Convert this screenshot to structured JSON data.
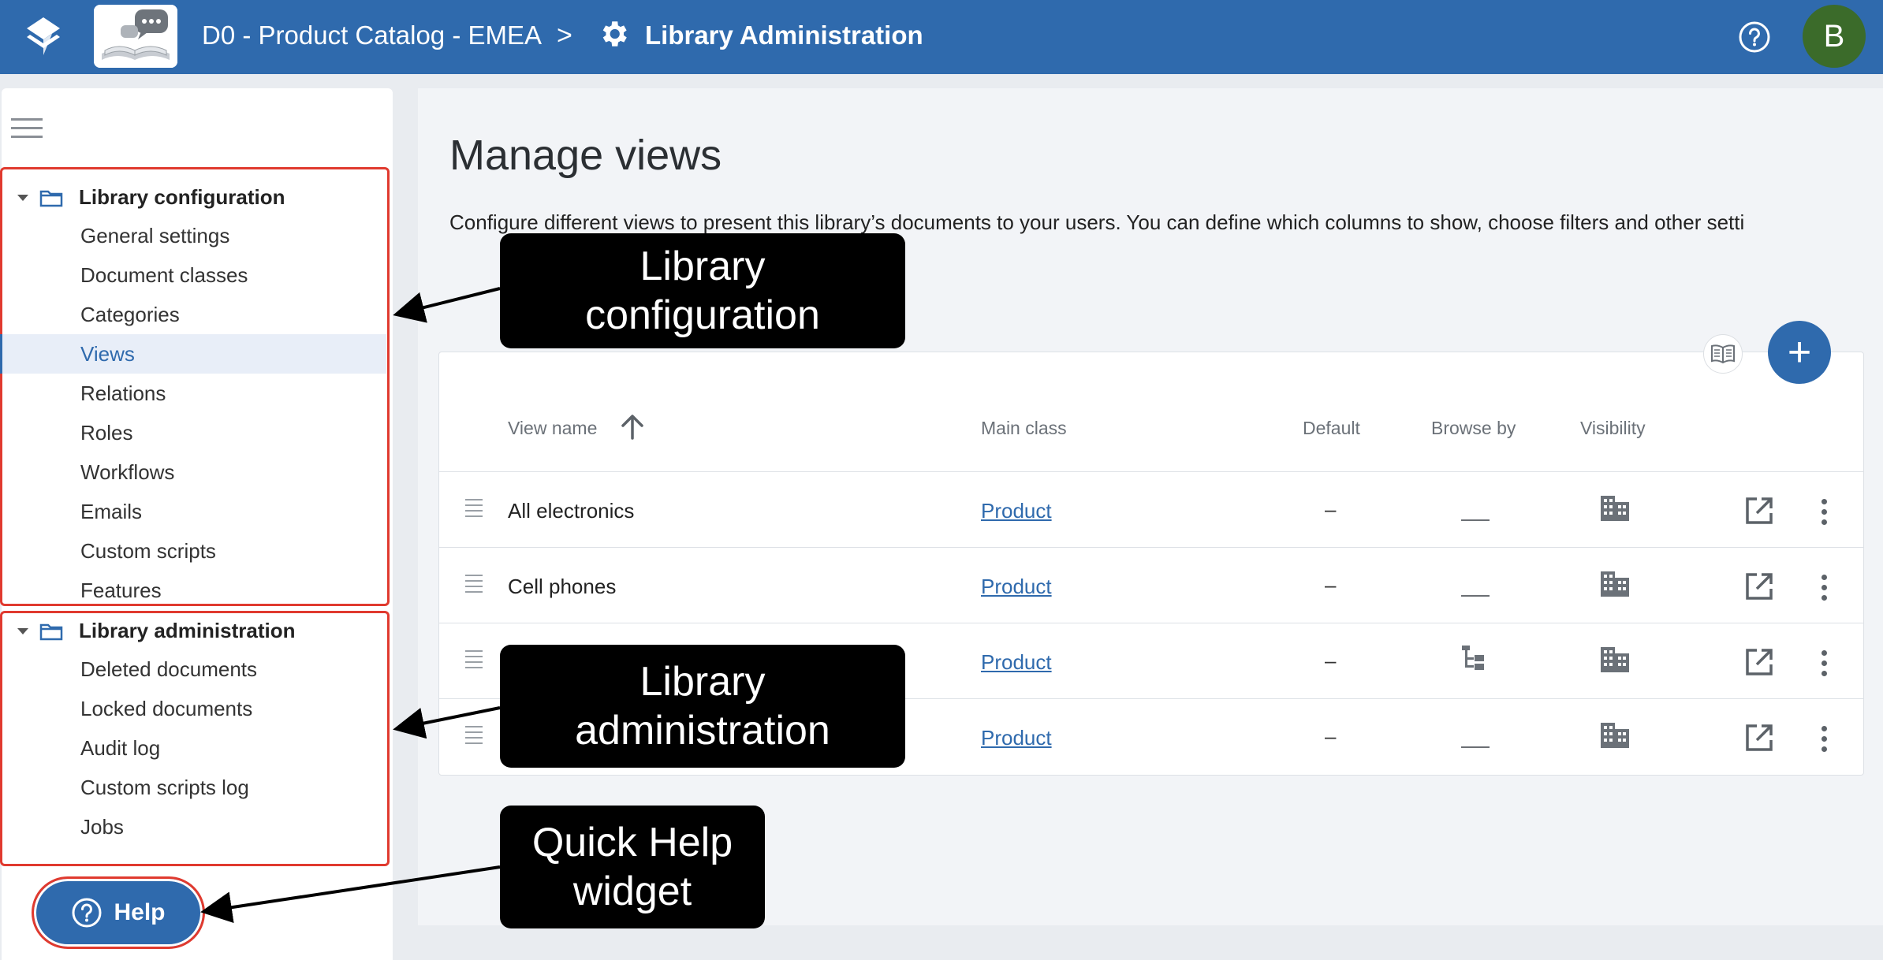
{
  "header": {
    "library_name": "D0 - Product Catalog - EMEA",
    "separator": ">",
    "page_crumb": "Library Administration",
    "avatar_letter": "B"
  },
  "sidebar": {
    "groups": [
      {
        "label": "Library configuration",
        "items": [
          "General settings",
          "Document classes",
          "Categories",
          "Views",
          "Relations",
          "Roles",
          "Workflows",
          "Emails",
          "Custom scripts",
          "Features"
        ]
      },
      {
        "label": "Library administration",
        "items": [
          "Deleted documents",
          "Locked documents",
          "Audit log",
          "Custom scripts log",
          "Jobs"
        ]
      }
    ],
    "active_item": "Views",
    "help_label": "Help"
  },
  "main": {
    "title": "Manage views",
    "description": "Configure different views to present this library’s documents to your users. You can define which columns to show, choose filters and other setti",
    "columns": [
      "View name",
      "Main class",
      "Default",
      "Browse by",
      "Visibility"
    ],
    "rows": [
      {
        "name": "All electronics",
        "main_class": "Product",
        "default": "–",
        "browse_by": "none",
        "visibility": "organization"
      },
      {
        "name": "Cell phones",
        "main_class": "Product",
        "default": "–",
        "browse_by": "none",
        "visibility": "organization"
      },
      {
        "name": "",
        "main_class": "Product",
        "default": "–",
        "browse_by": "tree",
        "visibility": "organization"
      },
      {
        "name": "",
        "main_class": "Product",
        "default": "–",
        "browse_by": "none",
        "visibility": "organization"
      }
    ],
    "add_label": "+"
  },
  "callouts": {
    "config_line1": "Library",
    "config_line2": "configuration",
    "admin_line1": "Library",
    "admin_line2": "administration",
    "help_line1": "Quick Help",
    "help_line2": "widget"
  },
  "colors": {
    "brand": "#2f6aad",
    "highlight_border": "#e03a2f",
    "avatar": "#3b6b2a"
  }
}
